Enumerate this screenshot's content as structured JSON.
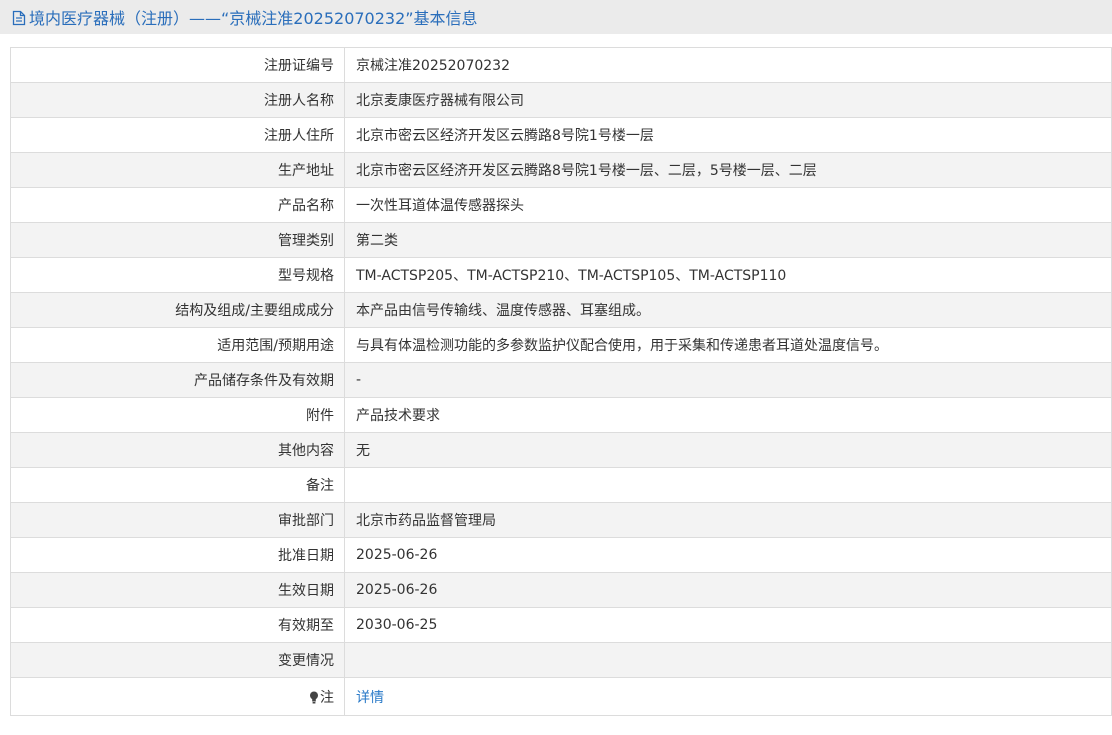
{
  "header": {
    "title": "境内医疗器械（注册）——“京械注准20252070232”基本信息"
  },
  "rows": [
    {
      "label": "注册证编号",
      "value": "京械注准20252070232"
    },
    {
      "label": "注册人名称",
      "value": "北京麦康医疗器械有限公司"
    },
    {
      "label": "注册人住所",
      "value": "北京市密云区经济开发区云腾路8号院1号楼一层"
    },
    {
      "label": "生产地址",
      "value": "北京市密云区经济开发区云腾路8号院1号楼一层、二层，5号楼一层、二层"
    },
    {
      "label": "产品名称",
      "value": "一次性耳道体温传感器探头"
    },
    {
      "label": "管理类别",
      "value": "第二类"
    },
    {
      "label": "型号规格",
      "value": "TM-ACTSP205、TM-ACTSP210、TM-ACTSP105、TM-ACTSP110"
    },
    {
      "label": "结构及组成/主要组成成分",
      "value": "本产品由信号传输线、温度传感器、耳塞组成。"
    },
    {
      "label": "适用范围/预期用途",
      "value": "与具有体温检测功能的多参数监护仪配合使用，用于采集和传递患者耳道处温度信号。"
    },
    {
      "label": "产品储存条件及有效期",
      "value": "-"
    },
    {
      "label": "附件",
      "value": "产品技术要求"
    },
    {
      "label": "其他内容",
      "value": "无"
    },
    {
      "label": "备注",
      "value": ""
    },
    {
      "label": "审批部门",
      "value": "北京市药品监督管理局"
    },
    {
      "label": "批准日期",
      "value": "2025-06-26"
    },
    {
      "label": "生效日期",
      "value": "2025-06-26"
    },
    {
      "label": "有效期至",
      "value": "2030-06-25"
    },
    {
      "label": "变更情况",
      "value": ""
    }
  ],
  "note": {
    "label": "注",
    "link": "详情"
  },
  "colors": {
    "accent": "#2a6ebb",
    "link": "#2a7ac8",
    "header_bg": "#ebebeb",
    "stripe": "#f3f3f3",
    "border": "#dcdcdc"
  }
}
